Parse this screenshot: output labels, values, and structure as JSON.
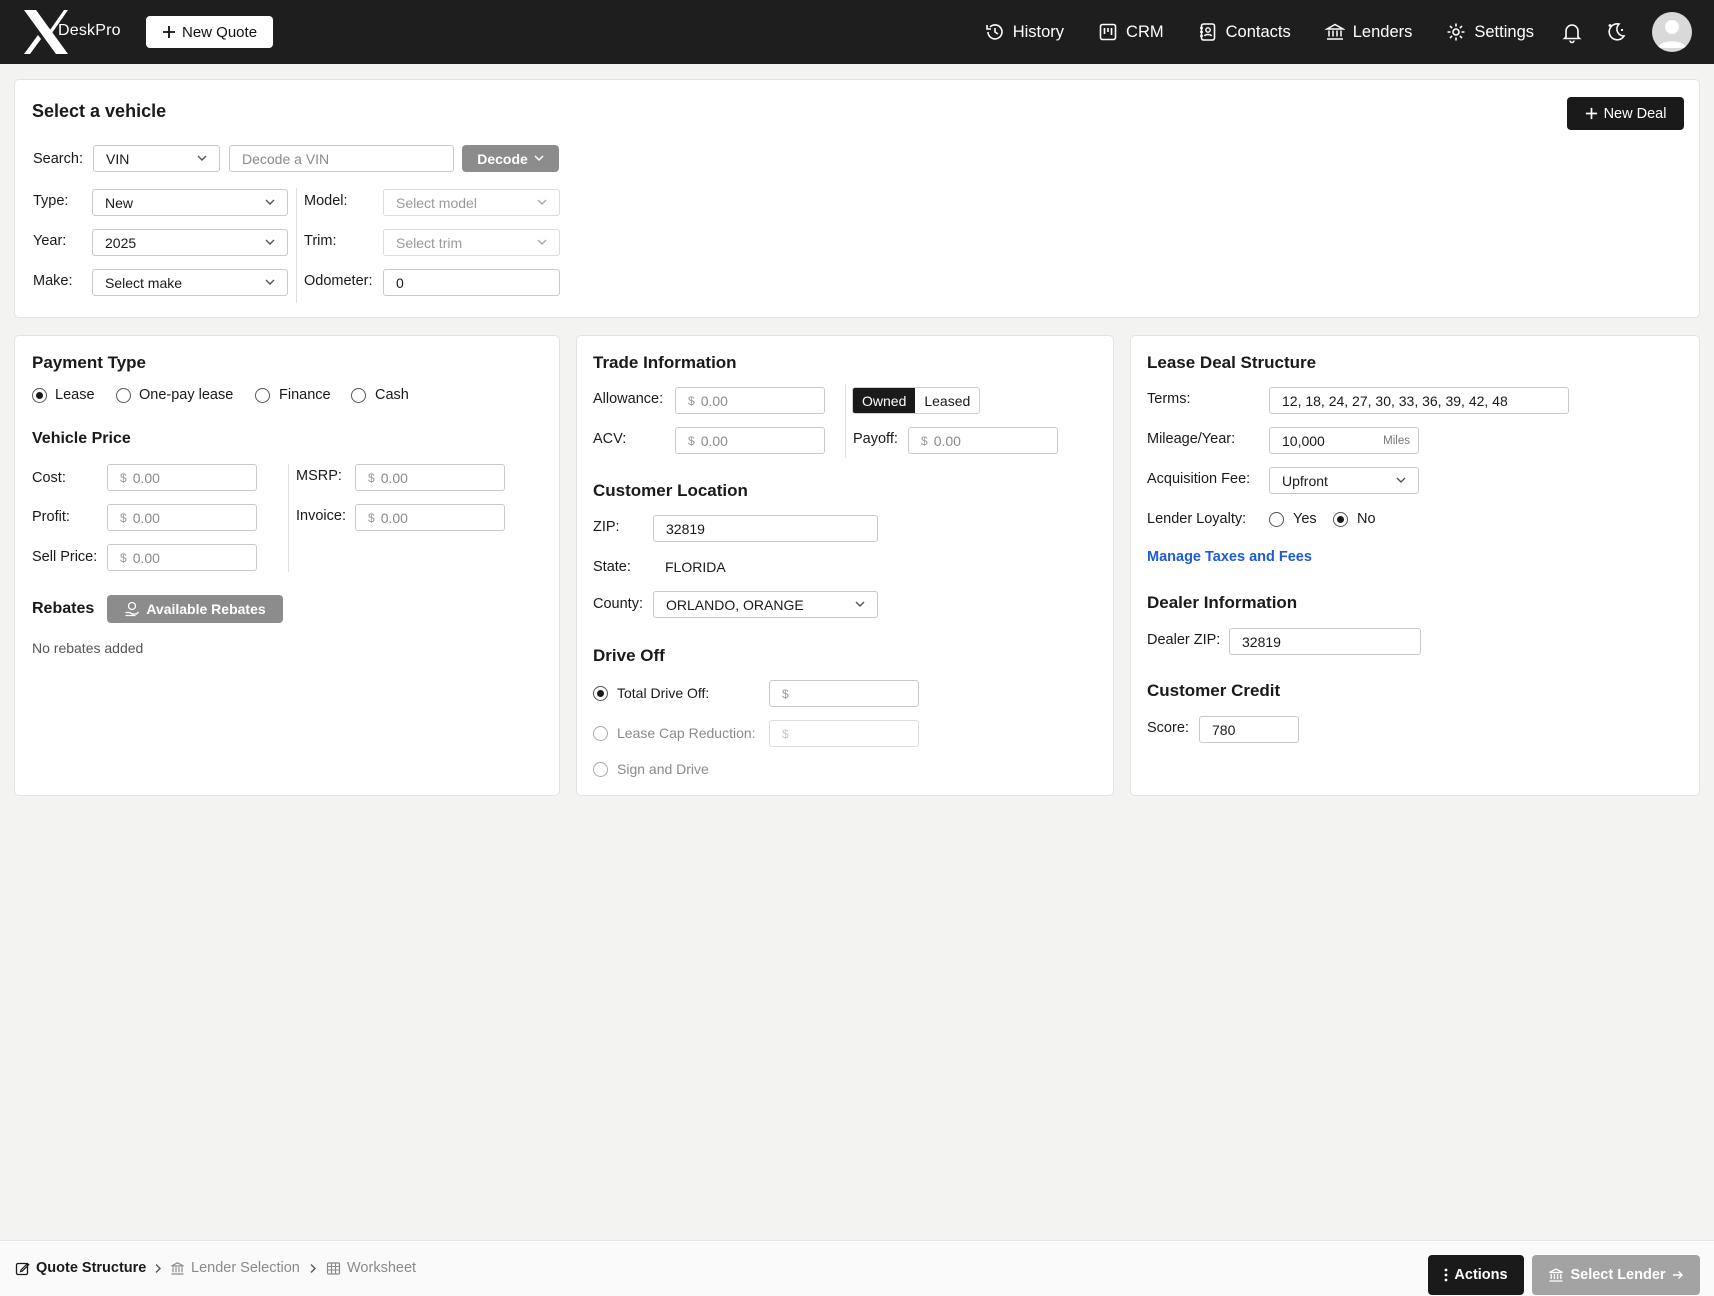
{
  "header": {
    "logo_text": "DeskPro",
    "new_quote_label": "New Quote",
    "nav": [
      {
        "label": "History",
        "icon": "history-icon"
      },
      {
        "label": "CRM",
        "icon": "crm-icon"
      },
      {
        "label": "Contacts",
        "icon": "contacts-icon"
      },
      {
        "label": "Lenders",
        "icon": "bank-icon"
      },
      {
        "label": "Settings",
        "icon": "gear-icon"
      }
    ]
  },
  "vehicle": {
    "title": "Select a vehicle",
    "new_deal_label": "New Deal",
    "search_label": "Search:",
    "search_type": "VIN",
    "vin_placeholder": "Decode a VIN",
    "decode_label": "Decode",
    "type_label": "Type:",
    "type_value": "New",
    "year_label": "Year:",
    "year_value": "2025",
    "make_label": "Make:",
    "make_value": "Select make",
    "model_label": "Model:",
    "model_value": "Select model",
    "trim_label": "Trim:",
    "trim_value": "Select trim",
    "odometer_label": "Odometer:",
    "odometer_value": "0"
  },
  "payment": {
    "title": "Payment Type",
    "options": [
      "Lease",
      "One-pay lease",
      "Finance",
      "Cash"
    ],
    "selected": "Lease",
    "price_title": "Vehicle Price",
    "cost_label": "Cost:",
    "profit_label": "Profit:",
    "sell_label": "Sell Price:",
    "msrp_label": "MSRP:",
    "invoice_label": "Invoice:",
    "currency": "$",
    "zero": "0.00",
    "rebates_title": "Rebates",
    "available_rebates_label": "Available Rebates",
    "no_rebates": "No rebates added"
  },
  "trade": {
    "title": "Trade Information",
    "allowance_label": "Allowance:",
    "acv_label": "ACV:",
    "payoff_label": "Payoff:",
    "owned_label": "Owned",
    "leased_label": "Leased",
    "currency": "$",
    "zero": "0.00",
    "location_title": "Customer Location",
    "zip_label": "ZIP:",
    "zip_value": "32819",
    "state_label": "State:",
    "state_value": "FLORIDA",
    "county_label": "County:",
    "county_value": "ORLANDO, ORANGE",
    "driveoff_title": "Drive Off",
    "total_driveoff_label": "Total Drive Off:",
    "cap_reduction_label": "Lease Cap Reduction:",
    "sign_drive_label": "Sign and Drive"
  },
  "lease": {
    "title": "Lease Deal Structure",
    "terms_label": "Terms:",
    "terms_value": "12, 18, 24, 27, 30, 33, 36, 39, 42, 48",
    "mileage_label": "Mileage/Year:",
    "mileage_value": "10,000",
    "mileage_unit": "Miles",
    "acq_fee_label": "Acquisition Fee:",
    "acq_fee_value": "Upfront",
    "loyalty_label": "Lender Loyalty:",
    "loyalty_yes": "Yes",
    "loyalty_no": "No",
    "manage_link": "Manage Taxes and Fees",
    "dealer_title": "Dealer Information",
    "dealer_zip_label": "Dealer ZIP:",
    "dealer_zip_value": "32819",
    "credit_title": "Customer Credit",
    "score_label": "Score:",
    "score_value": "780"
  },
  "footer": {
    "crumbs": [
      "Quote Structure",
      "Lender Selection",
      "Worksheet"
    ],
    "actions_label": "Actions",
    "select_lender_label": "Select Lender"
  }
}
